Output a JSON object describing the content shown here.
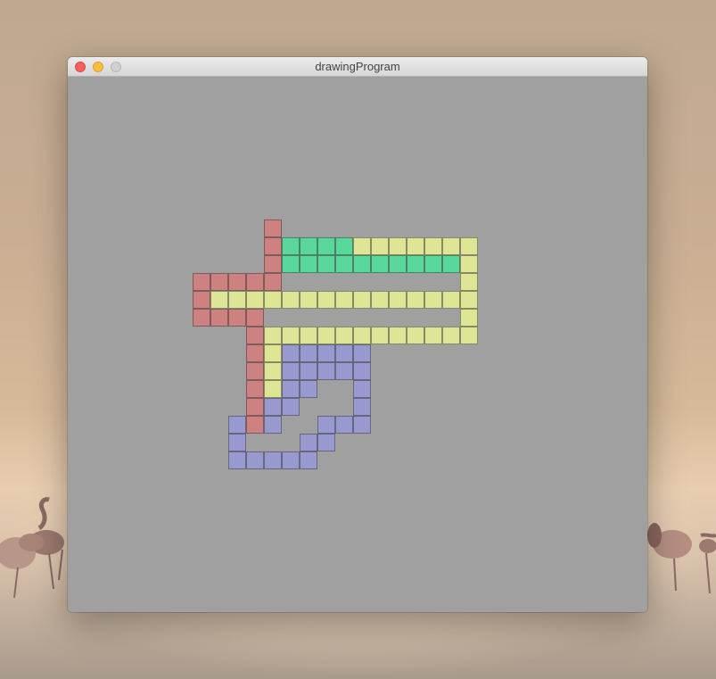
{
  "window": {
    "title": "drawingProgram",
    "buttons": {
      "close": "close-window",
      "minimize": "minimize-window",
      "zoom": "zoom-window"
    }
  },
  "canvas": {
    "background": "#a0a0a0",
    "cell_size": 20,
    "cell_border_color": "#4a4a4a"
  },
  "shapes": [
    {
      "name": "red",
      "color": "#cd8181",
      "cells": [
        [
          11,
          8
        ],
        [
          11,
          9
        ],
        [
          11,
          10
        ],
        [
          7,
          11
        ],
        [
          8,
          11
        ],
        [
          9,
          11
        ],
        [
          10,
          11
        ],
        [
          11,
          11
        ],
        [
          7,
          12
        ],
        [
          7,
          13
        ],
        [
          8,
          13
        ],
        [
          9,
          13
        ],
        [
          10,
          13
        ],
        [
          10,
          14
        ],
        [
          10,
          15
        ],
        [
          10,
          16
        ],
        [
          10,
          17
        ],
        [
          10,
          18
        ],
        [
          9,
          19
        ],
        [
          10,
          19
        ]
      ]
    },
    {
      "name": "green",
      "color": "#5ad89c",
      "cells": [
        [
          12,
          9
        ],
        [
          13,
          9
        ],
        [
          14,
          9
        ],
        [
          15,
          9
        ],
        [
          12,
          10
        ],
        [
          13,
          10
        ],
        [
          14,
          10
        ],
        [
          15,
          10
        ],
        [
          16,
          10
        ],
        [
          17,
          10
        ],
        [
          18,
          10
        ],
        [
          19,
          10
        ],
        [
          20,
          10
        ],
        [
          21,
          10
        ]
      ]
    },
    {
      "name": "yellow",
      "color": "#dee696",
      "cells": [
        [
          16,
          9
        ],
        [
          17,
          9
        ],
        [
          18,
          9
        ],
        [
          19,
          9
        ],
        [
          20,
          9
        ],
        [
          21,
          9
        ],
        [
          22,
          9
        ],
        [
          22,
          10
        ],
        [
          22,
          11
        ],
        [
          8,
          12
        ],
        [
          9,
          12
        ],
        [
          10,
          12
        ],
        [
          11,
          12
        ],
        [
          12,
          12
        ],
        [
          13,
          12
        ],
        [
          14,
          12
        ],
        [
          15,
          12
        ],
        [
          16,
          12
        ],
        [
          17,
          12
        ],
        [
          18,
          12
        ],
        [
          19,
          12
        ],
        [
          20,
          12
        ],
        [
          21,
          12
        ],
        [
          22,
          12
        ],
        [
          22,
          13
        ],
        [
          11,
          14
        ],
        [
          12,
          14
        ],
        [
          13,
          14
        ],
        [
          14,
          14
        ],
        [
          15,
          14
        ],
        [
          16,
          14
        ],
        [
          17,
          14
        ],
        [
          18,
          14
        ],
        [
          19,
          14
        ],
        [
          20,
          14
        ],
        [
          21,
          14
        ],
        [
          22,
          14
        ],
        [
          11,
          15
        ],
        [
          11,
          16
        ],
        [
          11,
          17
        ],
        [
          11,
          18
        ]
      ]
    },
    {
      "name": "blue",
      "color": "#9899cf",
      "cells": [
        [
          12,
          15
        ],
        [
          13,
          15
        ],
        [
          14,
          15
        ],
        [
          15,
          15
        ],
        [
          16,
          15
        ],
        [
          12,
          16
        ],
        [
          13,
          16
        ],
        [
          14,
          16
        ],
        [
          15,
          16
        ],
        [
          16,
          16
        ],
        [
          12,
          17
        ],
        [
          13,
          17
        ],
        [
          16,
          17
        ],
        [
          11,
          18
        ],
        [
          12,
          18
        ],
        [
          16,
          18
        ],
        [
          9,
          19
        ],
        [
          11,
          19
        ],
        [
          14,
          19
        ],
        [
          15,
          19
        ],
        [
          16,
          19
        ],
        [
          9,
          20
        ],
        [
          13,
          20
        ],
        [
          14,
          20
        ],
        [
          9,
          21
        ],
        [
          10,
          21
        ],
        [
          11,
          21
        ],
        [
          12,
          21
        ],
        [
          13,
          21
        ]
      ]
    }
  ]
}
